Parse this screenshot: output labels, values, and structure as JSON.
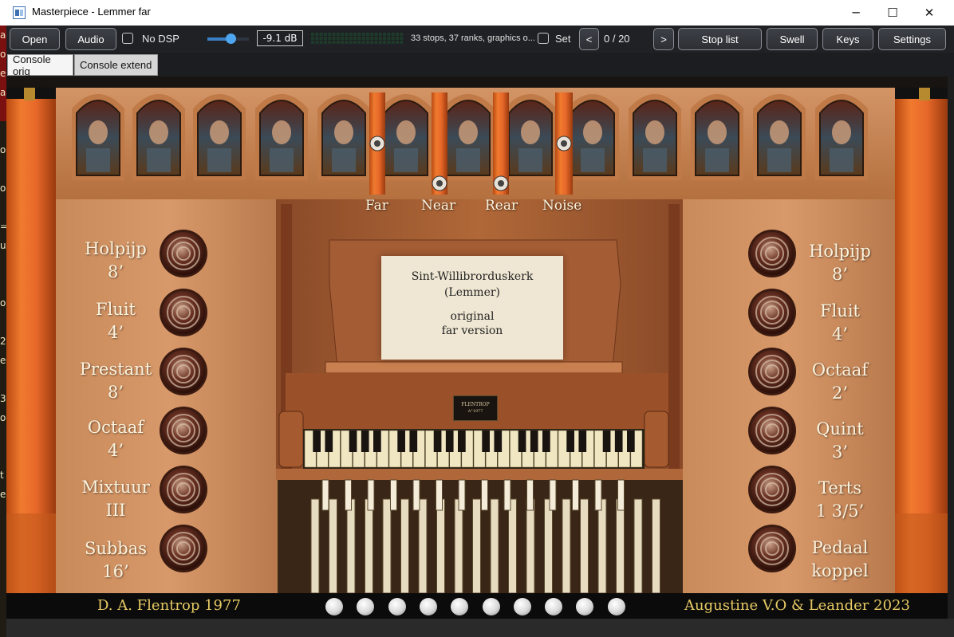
{
  "window": {
    "title": "Masterpiece - Lemmer far",
    "minimize_icon": "─",
    "maximize_icon": "☐",
    "close_icon": "✕"
  },
  "toolbar": {
    "open_label": "Open",
    "audio_label": "Audio",
    "no_dsp_label": "No DSP",
    "no_dsp_checked": false,
    "volume_value": 0.55,
    "volume_db": "-9.1 dB",
    "info_text": "33 stops, 37 ranks, graphics o...",
    "set_label": "Set",
    "set_checked": false,
    "prev_label": "<",
    "counter": "0 / 20",
    "next_label": ">",
    "stoplist_label": "Stop list",
    "swell_label": "Swell",
    "keys_label": "Keys",
    "settings_label": "Settings",
    "accent_color": "#4ea6f0"
  },
  "tabs": [
    {
      "label": "Console orig",
      "active": true
    },
    {
      "label": "Console extend",
      "active": false
    }
  ],
  "channels": [
    {
      "label": "Far"
    },
    {
      "label": "Near"
    },
    {
      "label": "Rear"
    },
    {
      "label": "Noise"
    }
  ],
  "music_card": {
    "line1": "Sint-Willibrorduskerk",
    "line2": "(Lemmer)",
    "line3": "original",
    "line4": "far version"
  },
  "nameplate": {
    "line1": "FLENTROP",
    "line2": "A°1977"
  },
  "left_stops": [
    {
      "name": "Holpijp",
      "size": "8’"
    },
    {
      "name": "Fluit",
      "size": "4’"
    },
    {
      "name": "Prestant",
      "size": "8’"
    },
    {
      "name": "Octaaf",
      "size": "4’"
    },
    {
      "name": "Mixtuur",
      "size": "III"
    },
    {
      "name": "Subbas",
      "size": "16’"
    }
  ],
  "right_stops": [
    {
      "name": "Holpijp",
      "size": "8’"
    },
    {
      "name": "Fluit",
      "size": "4’"
    },
    {
      "name": "Octaaf",
      "size": "2’"
    },
    {
      "name": "Quint",
      "size": "3’"
    },
    {
      "name": "Terts",
      "size": "1 3/5’"
    },
    {
      "name": "Pedaal",
      "size": "koppel"
    }
  ],
  "footer": {
    "builder": "D. A. Flentrop 1977",
    "credits": "Augustine V.O & Leander 2023",
    "piston_count": 10
  },
  "left_strip_chars": [
    "a",
    "o",
    "e",
    "a",
    "",
    "",
    "o",
    "",
    "o",
    "",
    "=",
    "u",
    "",
    "",
    "o",
    "",
    "2",
    "e",
    "",
    "3",
    "o",
    "",
    "",
    "t",
    "e"
  ]
}
